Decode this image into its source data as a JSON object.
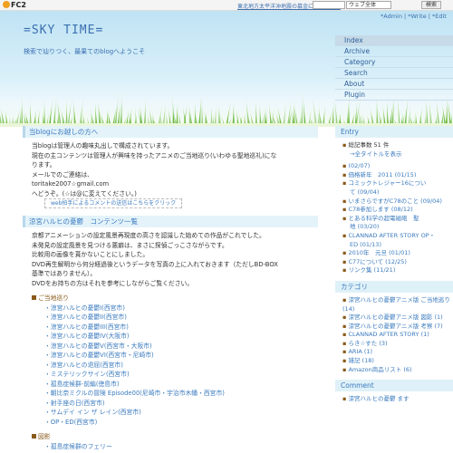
{
  "fc2bar": {
    "logo": "FC2",
    "news": "東北地方太平洋沖地震の募金につきまして",
    "search_select": "ウェブ全体",
    "search_button": "検索"
  },
  "header": {
    "toplinks": "*Admin | *Write | *Edit",
    "title": "=SKY TIME=",
    "tagline": "検索で辿りつく、最果てのblogへようこそ"
  },
  "menu": [
    "Index",
    "Archive",
    "Category",
    "Search",
    "About",
    "Plugin"
  ],
  "entry1": {
    "title": "当blogにお越しの方へ",
    "lines": [
      "当blogは管理人の趣味丸出しで構成されています。",
      "現在の主コンテンツは管理人が興味を持ったアニメのご当地巡り(いわゆる聖地巡礼)にな",
      "ります。",
      "メールでのご連絡は、",
      "toritake2007☆gmail.com",
      "へどうぞ。(☆は@に変えてください。)"
    ],
    "mail_link": "web拍手によるコメントの送信はこちらをクリック"
  },
  "entry2": {
    "title": "涼宮ハルヒの憂鬱　コンテンツ一覧",
    "lines": [
      "京都アニメーションの設定風景再現度の高さを認識した始めての作品がこれでした。",
      "未発見の設定風景を見つける悪癖は、まさに探偵ごっこさながらです。",
      "比較用の画像を貰かないことにしました。",
      "DVD再生解明から何分経過後というデータを写真の上に入れておきます（ただしBD-BOX",
      "基準ではありません）。",
      "DVDをお持ちの方はそれを参考にしながらご覧ください。"
    ],
    "section1": "ご当地巡り",
    "links1": [
      "涼宮ハルヒの憂鬱I(西宮市)",
      "涼宮ハルヒの憂鬱II(西宮市)",
      "涼宮ハルヒの憂鬱III(西宮市)",
      "涼宮ハルヒの憂鬱IV(大阪市)",
      "涼宮ハルヒの憂鬱V(西宮市・大阪市)",
      "涼宮ハルヒの憂鬱VI(西宮市・尼崎市)",
      "涼宮ハルヒの退屈(西宮市)",
      "ミステリックサイン(西宮市)",
      "孤島症候群-前編(徳島市)",
      "朝比奈ミクルの冒険 Episode00(尼崎市・宇治市木幡・西宮市)",
      "射手座の日(西宮市)",
      "サムデイ イン ザ レイン(西宮市)",
      "OP・ED(西宮市)"
    ],
    "section2": "図影",
    "links2": [
      "孤島症候群のフェリー"
    ]
  },
  "side": {
    "entry_title": "Entry",
    "entry_items": [
      "総記事数 51 件",
      "→全タイトルを表示",
      "",
      "(02/07)",
      "価格新年　2011 (01/15)",
      "コミックトレジャー16につい",
      "て (09/04)",
      "いまさらですがC78のこと (09/04)",
      "C78参加します (08/12)",
      "とある科学の超電磁砲　聖",
      "地 (03/20)",
      "CLANNAD AFTER STORY OP・",
      "ED (01/13)",
      "2010年　元旦 (01/01)",
      "C77について (12/25)",
      "リンク集 (11/21)"
    ],
    "category_title": "カテゴリ",
    "category_items": [
      "涼宮ハルヒの憂鬱アニメ版 ご当地巡り (14)",
      "涼宮ハルヒの憂鬱アニメ版 図影 (1)",
      "涼宮ハルヒの憂鬱アニメ版 考察 (7)",
      "CLANNAD AFTER STORY (1)",
      "らき☆すた (3)",
      "ARIA (1)",
      "雑記 (18)",
      "Amazon商品リスト (6)"
    ],
    "comment_title": "Comment",
    "comment_items": [
      "涼宮ハルヒの憂鬱 ます"
    ]
  }
}
